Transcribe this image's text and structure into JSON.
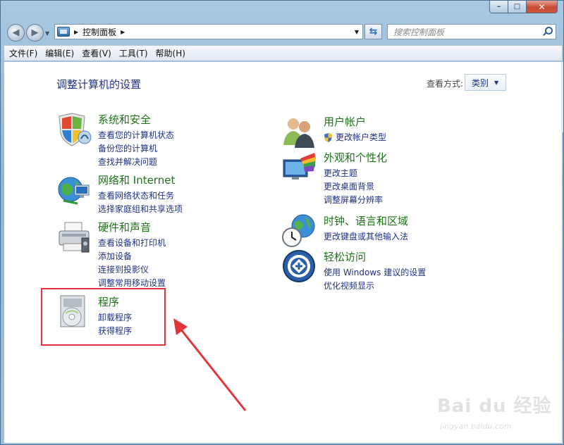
{
  "window": {
    "caption_buttons": {
      "minimize": "–",
      "maximize": "□",
      "close": "✕"
    }
  },
  "nav": {
    "back_icon": "arrow-left",
    "forward_icon": "arrow-right",
    "address": {
      "sep": "▶",
      "text": "控制面板",
      "sep2": "▶"
    },
    "search_placeholder": "搜索控制面板"
  },
  "menu": [
    "文件(F)",
    "编辑(E)",
    "查看(V)",
    "工具(T)",
    "帮助(H)"
  ],
  "content": {
    "title": "调整计算机的设置",
    "view_label": "查看方式:",
    "view_value": "类别"
  },
  "categories": {
    "system": {
      "title": "系统和安全",
      "links": [
        "查看您的计算机状态",
        "备份您的计算机",
        "查找并解决问题"
      ]
    },
    "network": {
      "title": "网络和 Internet",
      "links": [
        "查看网络状态和任务",
        "选择家庭组和共享选项"
      ]
    },
    "hardware": {
      "title": "硬件和声音",
      "links": [
        "查看设备和打印机",
        "添加设备",
        "连接到投影仪",
        "调整常用移动设置"
      ]
    },
    "programs": {
      "title": "程序",
      "links": [
        "卸载程序",
        "获得程序"
      ]
    },
    "users": {
      "title": "用户帐户",
      "links": [
        "更改帐户类型"
      ]
    },
    "appearance": {
      "title": "外观和个性化",
      "links": [
        "更改主题",
        "更改桌面背景",
        "调整屏幕分辨率"
      ]
    },
    "clock": {
      "title": "时钟、语言和区域",
      "links": [
        "更改键盘或其他输入法"
      ]
    },
    "ease": {
      "title": "轻松访问",
      "links": [
        "使用 Windows 建议的设置",
        "优化视频显示"
      ]
    }
  },
  "watermark": {
    "brand": "Bai du 经验",
    "url": "jingyan.baidu.com"
  },
  "colors": {
    "link": "#1e3287",
    "category_title": "#1d7219",
    "highlight": "#e2343b"
  }
}
